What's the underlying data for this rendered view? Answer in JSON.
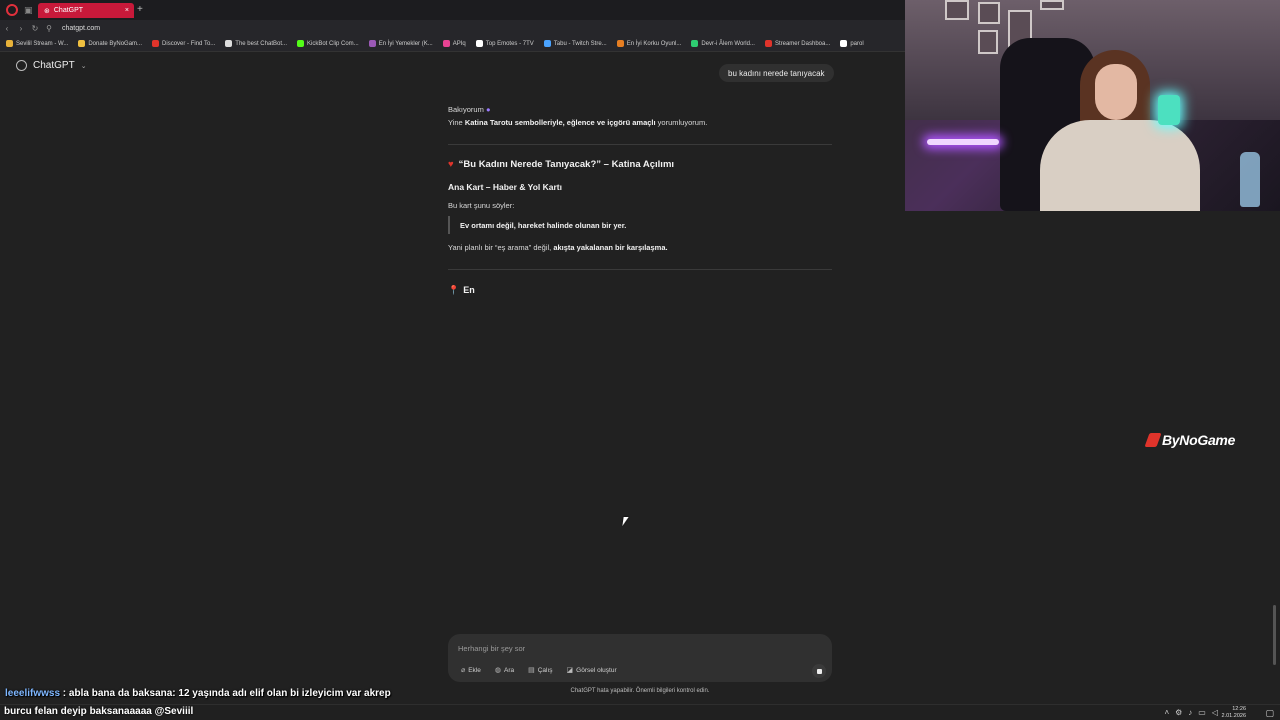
{
  "browser": {
    "active_tab_label": "ChatGPT",
    "url": "chatgpt.com",
    "bookmarks": [
      {
        "label": "Sevilil Stream - W...",
        "color": "#e8b23a"
      },
      {
        "label": "Donate ByNoGam...",
        "color": "#f0c040"
      },
      {
        "label": "Discover - Find To...",
        "color": "#e0342b"
      },
      {
        "label": "The best ChatBot...",
        "color": "#dddddd"
      },
      {
        "label": "KickBot Clip Com...",
        "color": "#53fc18"
      },
      {
        "label": "En İyi Yemekler (K...",
        "color": "#9b59b6"
      },
      {
        "label": "APIq",
        "color": "#e84393"
      },
      {
        "label": "Top Emotes - 7TV",
        "color": "#ffffff"
      },
      {
        "label": "Tabu - Twitch Stre...",
        "color": "#4aa3ff"
      },
      {
        "label": "En İyi Korku Oyunl...",
        "color": "#e67e22"
      },
      {
        "label": "Devr-i Âlem World...",
        "color": "#2ecc71"
      },
      {
        "label": "Streamer Dashboa...",
        "color": "#e0342b"
      },
      {
        "label": "parol",
        "color": "#ffffff"
      }
    ]
  },
  "chatgpt": {
    "model_label": "ChatGPT",
    "user_message": "bu kadını nerede tanıyacak",
    "status": "Bakıyorum",
    "intro": {
      "pre": "Yine ",
      "bold": "Katina Tarotu sembolleriyle, eğlence ve içgörü amaçlı",
      "post": " yorumluyorum."
    },
    "heading_katina": "“Bu Kadını Nerede Tanıyacak?” – Katina Açılımı",
    "heading_anakart": "Ana Kart – Haber & Yol Kartı",
    "kart_soyler": "Bu kart şunu söyler:",
    "quote": "Ev ortamı değil, hareket halinde olunan bir yer.",
    "yani": {
      "pre": "Yani planlı bir “eş arama” değil, ",
      "bold": "akışta yakalanan bir karşılaşma."
    },
    "heading_en": "En",
    "composer": {
      "placeholder": "Herhangi bir şey sor",
      "tools": {
        "ekle": "Ekle",
        "ara": "Ara",
        "calis": "Çalış",
        "gorsel": "Görsel oluştur"
      }
    },
    "disclaimer": "ChatGPT hata yapabilir. Önemli bilgileri kontrol edin."
  },
  "overlay": {
    "brand": "ByNoGame",
    "chat_user": "leeelifwwss",
    "chat_message": " : abla bana da baksana: 12 yaşında adı elif olan bi izleyicim var akrep",
    "chat_message_2": "burcu felan deyip baksanaaaaa @Seviiil"
  },
  "taskbar": {
    "time": "12:26",
    "date": "2.01.2026"
  }
}
